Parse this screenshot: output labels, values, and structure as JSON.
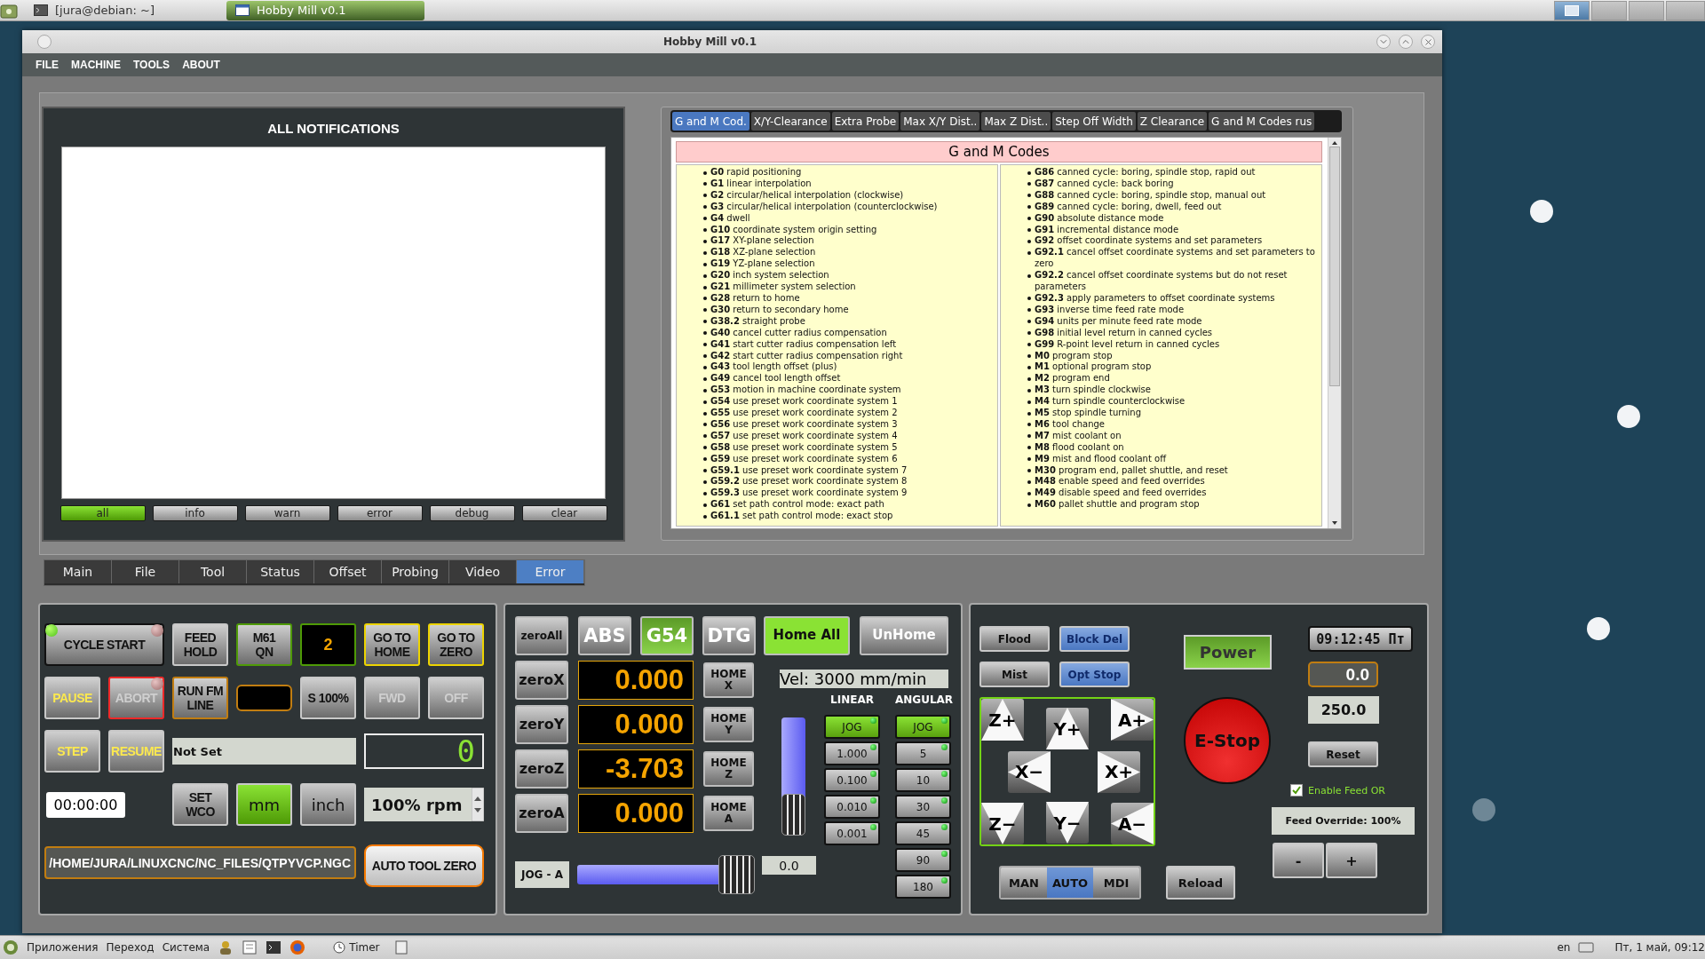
{
  "top_taskbar": {
    "tasks": [
      {
        "label": "[jura@debian: ~]",
        "selected": false
      },
      {
        "label": "Hobby Mill v0.1",
        "selected": true
      }
    ]
  },
  "window": {
    "title": "Hobby Mill v0.1"
  },
  "menu": [
    "FILE",
    "MACHINE",
    "TOOLS",
    "ABOUT"
  ],
  "notifications": {
    "title": "ALL NOTIFICATIONS",
    "filters": [
      {
        "label": "all",
        "selected": true
      },
      {
        "label": "info",
        "selected": false
      },
      {
        "label": "warn",
        "selected": false
      },
      {
        "label": "error",
        "selected": false
      },
      {
        "label": "debug",
        "selected": false
      },
      {
        "label": "clear",
        "selected": false
      }
    ]
  },
  "reference": {
    "tabs": [
      {
        "label": "G and M Cod.",
        "selected": true
      },
      {
        "label": "X/Y-Clearance",
        "selected": false
      },
      {
        "label": "Extra Probe",
        "selected": false
      },
      {
        "label": "Max X/Y Dist..",
        "selected": false
      },
      {
        "label": "Max Z Dist..",
        "selected": false
      },
      {
        "label": "Step Off Width",
        "selected": false
      },
      {
        "label": "Z Clearance",
        "selected": false
      },
      {
        "label": "G and M Codes rus",
        "selected": false
      }
    ],
    "title": "G and M Codes",
    "columns": [
      [
        "**G0** rapid positioning",
        "**G1** linear interpolation",
        "**G2** circular/helical interpolation (clockwise)",
        "**G3** circular/helical interpolation (counterclockwise)",
        "**G4** dwell",
        "**G10** coordinate system origin setting",
        "**G17** XY-plane selection",
        "**G18** XZ-plane selection",
        "**G19** YZ-plane selection",
        "**G20** inch system selection",
        "**G21** millimeter system selection",
        "**G28** return to home",
        "**G30** return to secondary home",
        "**G38.2** straight probe",
        "**G40** cancel cutter radius compensation",
        "**G41** start cutter radius compensation left",
        "**G42** start cutter radius compensation right",
        "**G43** tool length offset (plus)",
        "**G49** cancel tool length offset",
        "**G53** motion in machine coordinate system",
        "**G54** use preset work coordinate system 1",
        "**G55** use preset work coordinate system 2",
        "**G56** use preset work coordinate system 3",
        "**G57** use preset work coordinate system 4",
        "**G58** use preset work coordinate system 5",
        "**G59** use preset work coordinate system 6",
        "**G59.1** use preset work coordinate system 7",
        "**G59.2** use preset work coordinate system 8",
        "**G59.3** use preset work coordinate system 9",
        "**G61** set path control mode: exact path",
        "**G61.1** set path control mode: exact stop"
      ],
      [
        "**G86** canned cycle: boring, spindle stop, rapid out",
        "**G87** canned cycle: back boring",
        "**G88** canned cycle: boring, spindle stop, manual out",
        "**G89** canned cycle: boring, dwell, feed out",
        "**G90** absolute distance mode",
        "**G91** incremental distance mode",
        "**G92** offset coordinate systems and set parameters",
        "**G92.1** cancel offset coordinate systems and set parameters to zero",
        "**G92.2** cancel offset coordinate systems but do not reset parameters",
        "**G92.3** apply parameters to offset coordinate systems",
        "**G93** inverse time feed rate mode",
        "**G94** units per minute feed rate mode",
        "**G98** initial level return in canned cycles",
        "**G99** R-point level return in canned cycles",
        "**M0** program stop",
        "**M1** optional program stop",
        "**M2** program end",
        "**M3** turn spindle clockwise",
        "**M4** turn spindle counterclockwise",
        "**M5** stop spindle turning",
        "**M6** tool change",
        "**M7** mist coolant on",
        "**M8** flood coolant on",
        "**M9** mist and flood coolant off",
        "**M30** program end, pallet shuttle, and reset",
        "**M48** enable speed and feed overrides",
        "**M49** disable speed and feed overrides",
        "**M60** pallet shuttle and program stop"
      ]
    ]
  },
  "main_tabs": [
    {
      "label": "Main",
      "selected": false
    },
    {
      "label": "File",
      "selected": false
    },
    {
      "label": "Tool",
      "selected": false
    },
    {
      "label": "Status",
      "selected": false
    },
    {
      "label": "Offset",
      "selected": false
    },
    {
      "label": "Probing",
      "selected": false
    },
    {
      "label": "Video",
      "selected": false
    },
    {
      "label": "Error",
      "selected": true
    }
  ],
  "program_panel": {
    "controls": [
      {
        "kind": "cycle",
        "lines": [
          "CYCLE START"
        ],
        "status_on": true,
        "alarm_on": false
      },
      {
        "kind": "button",
        "lines": [
          "FEED",
          "HOLD"
        ]
      },
      {
        "kind": "button",
        "lines": [
          "M61",
          "QN"
        ],
        "color": "#4e9a06"
      },
      {
        "kind": "display",
        "value": "2",
        "color": "#4e9a06"
      },
      {
        "kind": "button",
        "lines": [
          "GO TO",
          "HOME"
        ],
        "color": "#edd400"
      },
      {
        "kind": "button",
        "lines": [
          "GO TO",
          "ZERO"
        ],
        "color": "#edd400"
      },
      {
        "kind": "button",
        "lines": [
          "PAUSE"
        ],
        "highlight": true
      },
      {
        "kind": "button",
        "lines": [
          "ABORT"
        ],
        "color": "#ef2929",
        "disabled": true,
        "alarm_on": false
      },
      {
        "kind": "button",
        "lines": [
          "RUN FM",
          "LINE"
        ],
        "color": "#c17d11"
      },
      {
        "kind": "blank_display",
        "color": "#c17d11"
      },
      {
        "kind": "button",
        "lines": [
          "S 100%"
        ]
      },
      {
        "kind": "button",
        "lines": [
          "FWD"
        ],
        "disabled": true
      },
      {
        "kind": "button",
        "lines": [
          "OFF"
        ],
        "disabled": true
      },
      {
        "kind": "button",
        "lines": [
          "STEP"
        ],
        "highlight": true
      },
      {
        "kind": "button",
        "lines": [
          "RESUME"
        ],
        "highlight": true
      },
      {
        "kind": "field",
        "value": "Not Set"
      },
      {
        "kind": "lcd",
        "value": "0"
      },
      {
        "kind": "timer",
        "value": "00:00:00"
      },
      {
        "kind": "button",
        "lines": [
          "SET",
          "WCO"
        ]
      },
      {
        "kind": "toggle",
        "label": "mm",
        "selected": true
      },
      {
        "kind": "toggle",
        "label": "inch",
        "selected": false
      },
      {
        "kind": "spinbox",
        "value": "100% rpm"
      },
      {
        "kind": "path",
        "value": "/HOME/JURA/LINUXCNC/NC_FILES/QTPYVCP.NGC",
        "color": "#c17d11"
      },
      {
        "kind": "wide_button",
        "lines": [
          "AUTO TOOL ZERO"
        ],
        "color": "#f57900"
      }
    ]
  },
  "position_panel": {
    "zero_all": "zeroAll",
    "modes": [
      {
        "label": "ABS",
        "selected": false
      },
      {
        "label": "G54",
        "selected": true
      },
      {
        "label": "DTG",
        "selected": false
      }
    ],
    "homing": [
      {
        "label": "Home All",
        "selected": true
      },
      {
        "label": "UnHome",
        "selected": false
      }
    ],
    "axes": [
      {
        "zero": "zeroX",
        "value": "0.000",
        "home": [
          "HOME",
          "X"
        ]
      },
      {
        "zero": "zeroY",
        "value": "0.000",
        "home": [
          "HOME",
          "Y"
        ]
      },
      {
        "zero": "zeroZ",
        "value": "-3.703",
        "home": [
          "HOME",
          "Z"
        ]
      },
      {
        "zero": "zeroA",
        "value": "0.000",
        "home": [
          "HOME",
          "A"
        ]
      }
    ],
    "velocity": "Vel: 3000 mm/min",
    "feed_slider": {
      "level": 1
    },
    "linear": {
      "title": "LINEAR",
      "steps": [
        {
          "label": "JOG",
          "selected": true
        },
        {
          "label": "1.000",
          "selected": false
        },
        {
          "label": "0.100",
          "selected": false
        },
        {
          "label": "0.010",
          "selected": false
        },
        {
          "label": "0.001",
          "selected": false
        }
      ]
    },
    "angular": {
      "title": "ANGULAR",
      "steps": [
        {
          "label": "JOG",
          "selected": true
        },
        {
          "label": "5",
          "selected": false
        },
        {
          "label": "10",
          "selected": false
        },
        {
          "label": "30",
          "selected": false
        },
        {
          "label": "45",
          "selected": false
        },
        {
          "label": "90",
          "selected": false
        },
        {
          "label": "180",
          "selected": false
        }
      ]
    },
    "jog_a": {
      "label": "JOG - A",
      "level": 1,
      "value": "0.0"
    }
  },
  "machine_panel": {
    "toggles": [
      {
        "label": "Flood",
        "on": false
      },
      {
        "label": "Block Del",
        "on": true
      },
      {
        "label": "Mist",
        "on": false
      },
      {
        "label": "Opt Stop",
        "on": true
      }
    ],
    "jog_buttons": [
      "Z+",
      "Y+",
      "A+",
      "X−",
      "X+",
      "Z−",
      "Y−",
      "A−"
    ],
    "modes": [
      {
        "label": "MAN",
        "selected": false
      },
      {
        "label": "AUTO",
        "selected": true
      },
      {
        "label": "MDI",
        "selected": false
      }
    ],
    "power": {
      "label": "Power",
      "on": true
    },
    "estop": "E-Stop",
    "reload": "Reload",
    "clock": "09:12:45 Пт",
    "spindle_speed": "0.0",
    "feed_value": "250.0",
    "reset": "Reset",
    "feed_or": {
      "label": "Enable Feed OR",
      "checked": true
    },
    "feed_override": "Feed Override: 100%",
    "override_buttons": [
      "-",
      "+"
    ]
  },
  "bottom_taskbar": {
    "menus": [
      "Приложения",
      "Переход",
      "Система"
    ],
    "timer_task": "Timer",
    "keyboard_layout": "en",
    "datetime": "Пт, 1 май, 09:12"
  }
}
